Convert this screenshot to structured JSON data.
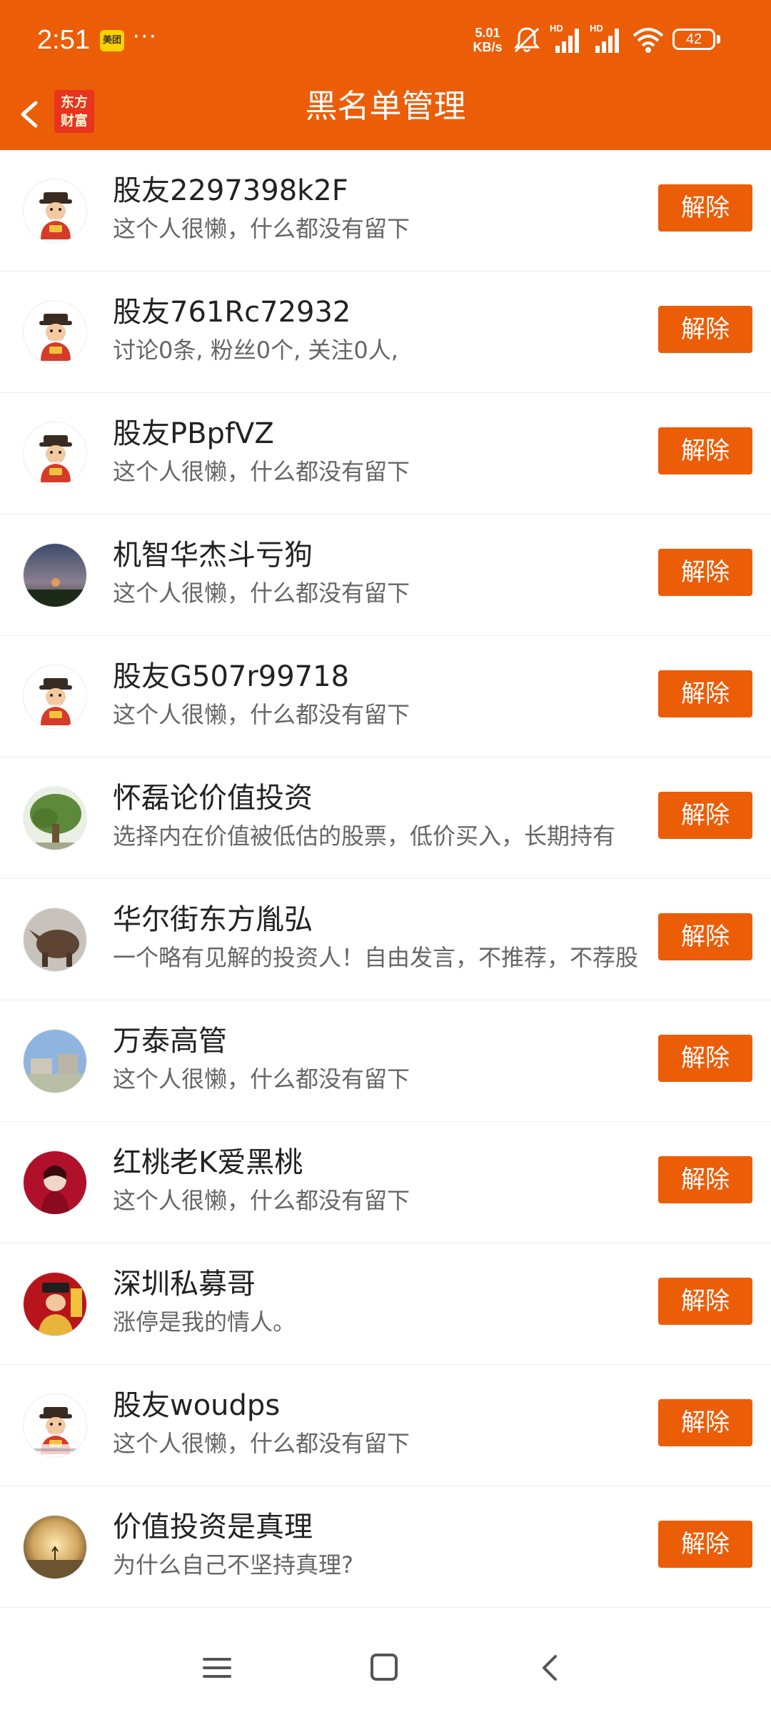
{
  "status_bar": {
    "time": "2:51",
    "notification_badge": "美团",
    "more_dots": "···",
    "net_speed_value": "5.01",
    "net_speed_unit": "KB/s",
    "signal_labels": [
      "HD",
      "HD"
    ],
    "battery": "42",
    "icons": [
      "mute-bell-icon",
      "signal-icon",
      "signal-icon",
      "wifi-icon",
      "battery-icon"
    ]
  },
  "header": {
    "title": "黑名单管理",
    "logo_line1": "东方",
    "logo_line2": "财富",
    "back_icon": "chevron-left-icon"
  },
  "blacklist": {
    "button_label": "解除",
    "users": [
      {
        "name": "股友2297398k2F",
        "desc": "这个人很懒，什么都没有留下",
        "avatar": "fortune-god"
      },
      {
        "name": "股友761Rc72932",
        "desc": "讨论0条, 粉丝0个, 关注0人,",
        "avatar": "fortune-god"
      },
      {
        "name": "股友PBpfVZ",
        "desc": "这个人很懒，什么都没有留下",
        "avatar": "fortune-god"
      },
      {
        "name": "机智华杰斗亏狗",
        "desc": "这个人很懒，什么都没有留下",
        "avatar": "dusk-sky"
      },
      {
        "name": "股友G507r99718",
        "desc": "这个人很懒，什么都没有留下",
        "avatar": "fortune-god"
      },
      {
        "name": "怀磊论价值投资",
        "desc": "选择内在价值被低估的股票，低价买入，长期持有",
        "avatar": "tree"
      },
      {
        "name": "华尔街东方胤弘",
        "desc": "一个略有见解的投资人！自由发言，不推荐，不荐股",
        "avatar": "bull"
      },
      {
        "name": "万泰高管",
        "desc": "这个人很懒，什么都没有留下",
        "avatar": "buildings"
      },
      {
        "name": "红桃老K爱黑桃",
        "desc": "这个人很懒，什么都没有留下",
        "avatar": "red-portrait"
      },
      {
        "name": "深圳私募哥",
        "desc": "涨停是我的情人。",
        "avatar": "red-fortune"
      },
      {
        "name": "股友woudps",
        "desc": "这个人很懒，什么都没有留下",
        "avatar": "fortune-god-review"
      },
      {
        "name": "价值投资是真理",
        "desc": "为什么自己不坚持真理?",
        "avatar": "sunset-field"
      }
    ]
  },
  "system_nav": {
    "icons": [
      "menu-icon",
      "home-icon",
      "back-icon"
    ]
  }
}
